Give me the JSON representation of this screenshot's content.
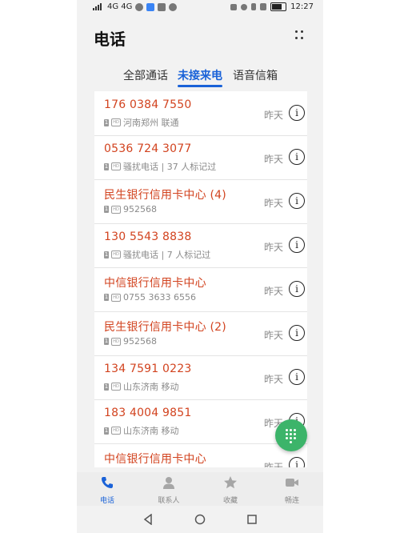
{
  "status_bar": {
    "left": "4G 4G",
    "time": "12:27"
  },
  "header": {
    "title": "电话"
  },
  "tabs": [
    "全部通话",
    "未接来电",
    "语音信箱"
  ],
  "active_tab": 1,
  "calls": [
    {
      "name": "176 0384 7550",
      "detail": "河南郑州 联通",
      "time": "昨天"
    },
    {
      "name": "0536 724 3077",
      "detail": "骚扰电话 | 37 人标记过",
      "time": "昨天"
    },
    {
      "name": "民生银行信用卡中心 (4)",
      "detail": "952568",
      "time": "昨天"
    },
    {
      "name": "130 5543 8838",
      "detail": "骚扰电话 | 7 人标记过",
      "time": "昨天"
    },
    {
      "name": "中信银行信用卡中心",
      "detail": "0755 3633 6556",
      "time": "昨天"
    },
    {
      "name": "民生银行信用卡中心 (2)",
      "detail": "952568",
      "time": "昨天"
    },
    {
      "name": "134 7591 0223",
      "detail": "山东济南 移动",
      "time": "昨天"
    },
    {
      "name": "183 4004 9851",
      "detail": "山东济南 移动",
      "time": "昨天"
    },
    {
      "name": "中信银行信用卡中心",
      "detail": "",
      "time": "昨天"
    }
  ],
  "row_badges": {
    "sim": "1",
    "hd": "HD"
  },
  "bottom_nav": [
    {
      "label": "电话",
      "icon": "phone-icon"
    },
    {
      "label": "联系人",
      "icon": "contacts-icon"
    },
    {
      "label": "收藏",
      "icon": "star-icon"
    },
    {
      "label": "畅连",
      "icon": "video-icon"
    }
  ],
  "active_nav": 0,
  "colors": {
    "accent": "#1a62d8",
    "missed": "#d2431f",
    "fab": "#3cb46a"
  }
}
